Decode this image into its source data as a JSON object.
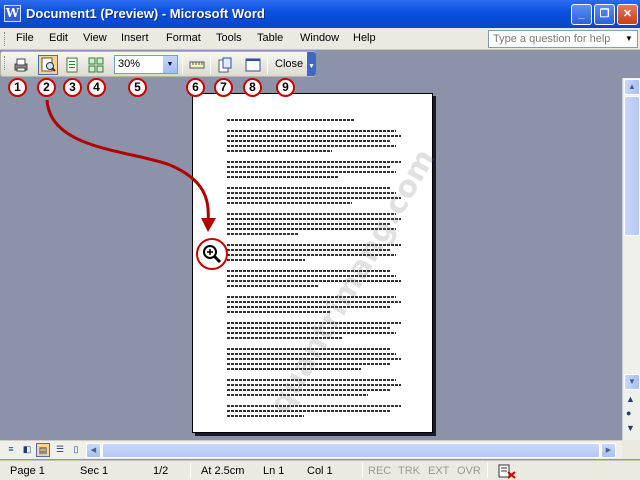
{
  "window": {
    "title": "Document1 (Preview) - Microsoft Word",
    "app_icon": "W",
    "controls": [
      "minimize-icon",
      "restore-icon",
      "close-icon"
    ]
  },
  "menu": {
    "items": [
      "File",
      "Edit",
      "View",
      "Insert",
      "Format",
      "Tools",
      "Table",
      "Window",
      "Help"
    ],
    "help_placeholder": "Type a question for help"
  },
  "toolbar": {
    "zoom_value": "30%",
    "close_label": "Close",
    "buttons": [
      "print-icon",
      "magnifier-icon",
      "one-page-icon",
      "multiple-pages-icon",
      "view-ruler-icon",
      "shrink-to-fit-icon",
      "full-screen-icon"
    ]
  },
  "callouts": [
    "1",
    "2",
    "3",
    "4",
    "5",
    "6",
    "7",
    "8",
    "9"
  ],
  "document": {
    "watermark": "quantrimang.com"
  },
  "statusbar": {
    "page": "Page  1",
    "sec": "Sec  1",
    "pages": "1/2",
    "at": "At  2.5cm",
    "ln": "Ln  1",
    "col": "Col  1",
    "rec": "REC",
    "trk": "TRK",
    "ext": "EXT",
    "ovr": "OVR"
  },
  "colors": {
    "titlebar": "#0a52e0",
    "callout_red": "#cc0000",
    "workspace": "#8c93a8"
  }
}
